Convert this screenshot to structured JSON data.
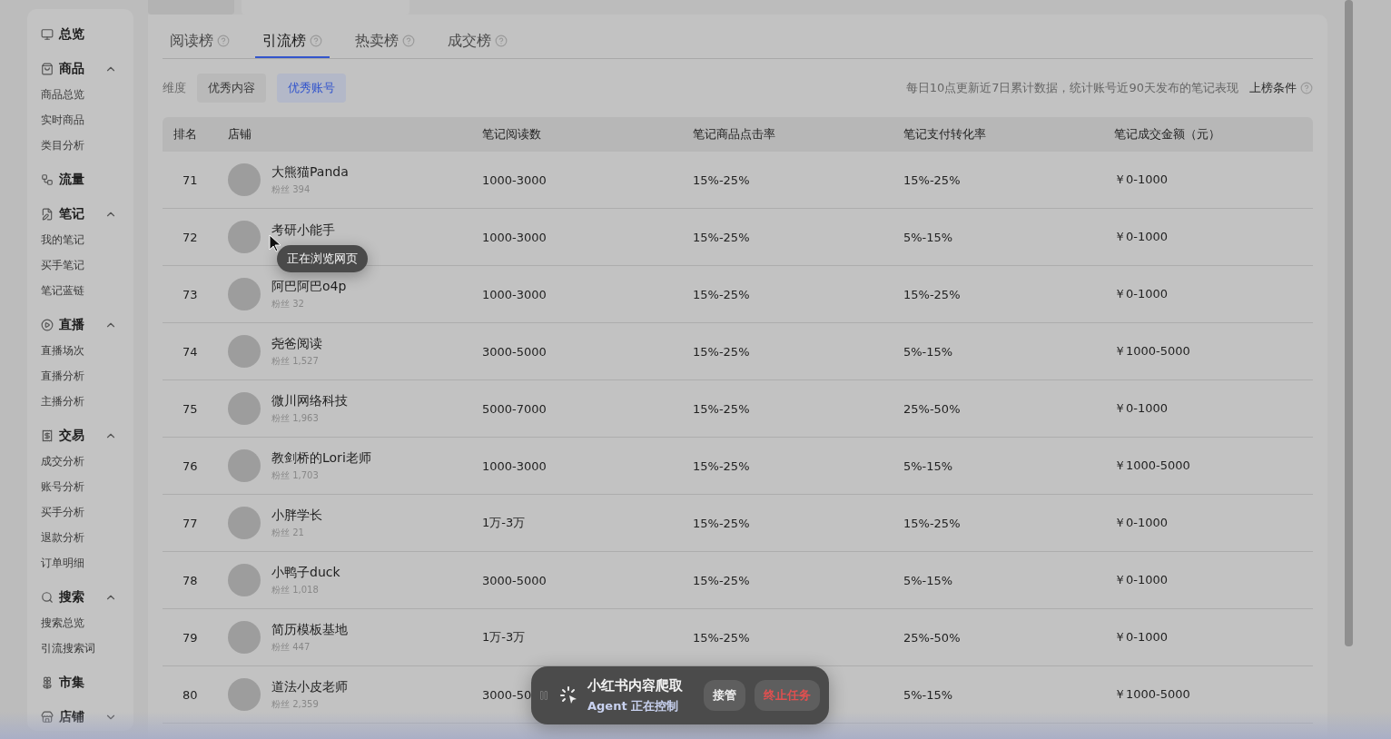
{
  "sidebar": [
    {
      "label": "总览"
    },
    {
      "label": "商品",
      "expanded": true,
      "children": [
        "商品总览",
        "实时商品",
        "类目分析"
      ]
    },
    {
      "label": "流量"
    },
    {
      "label": "笔记",
      "expanded": true,
      "children": [
        "我的笔记",
        "买手笔记",
        "笔记蓝链"
      ]
    },
    {
      "label": "直播",
      "expanded": true,
      "children": [
        "直播场次",
        "直播分析",
        "主播分析"
      ]
    },
    {
      "label": "交易",
      "expanded": true,
      "children": [
        "成交分析",
        "账号分析",
        "买手分析",
        "退款分析",
        "订单明细"
      ]
    },
    {
      "label": "搜索",
      "expanded": true,
      "children": [
        "搜索总览",
        "引流搜索词"
      ]
    },
    {
      "label": "市集"
    },
    {
      "label": "店铺",
      "expanded": false
    }
  ],
  "top_tabs": [
    {
      "selected": false
    },
    {
      "selected": true
    }
  ],
  "tabs": [
    {
      "label": "阅读榜",
      "selected": false
    },
    {
      "label": "引流榜",
      "selected": true
    },
    {
      "label": "热卖榜",
      "selected": false
    },
    {
      "label": "成交榜",
      "selected": false
    }
  ],
  "dimension": {
    "label": "维度",
    "options": [
      {
        "label": "优秀内容",
        "selected": false
      },
      {
        "label": "优秀账号",
        "selected": true
      }
    ]
  },
  "note": "每日10点更新近7日累计数据，统计账号近90天发布的笔记表现",
  "criteria": "上榜条件",
  "table": {
    "columns": [
      "排名",
      "店铺",
      "笔记阅读数",
      "笔记商品点击率",
      "笔记支付转化率",
      "笔记成交金额（元）"
    ],
    "rows": [
      {
        "rank": "71",
        "name": "大熊猫Panda",
        "fans": "粉丝 394",
        "reads": "1000-3000",
        "click": "15%-25%",
        "conversion": "15%-25%",
        "amount": "￥0-1000"
      },
      {
        "rank": "72",
        "name": "考研小能手",
        "reads": "1000-3000",
        "click": "15%-25%",
        "conversion": "5%-15%",
        "amount": "￥0-1000"
      },
      {
        "rank": "73",
        "name": "阿巴阿巴o4p",
        "fans": "粉丝 32",
        "reads": "1000-3000",
        "click": "15%-25%",
        "conversion": "15%-25%",
        "amount": "￥0-1000"
      },
      {
        "rank": "74",
        "name": "尧爸阅读",
        "fans": "粉丝 1,527",
        "reads": "3000-5000",
        "click": "15%-25%",
        "conversion": "5%-15%",
        "amount": "￥1000-5000"
      },
      {
        "rank": "75",
        "name": "微川网络科技",
        "fans": "粉丝 1,963",
        "reads": "5000-7000",
        "click": "15%-25%",
        "conversion": "25%-50%",
        "amount": "￥0-1000"
      },
      {
        "rank": "76",
        "name": "教剑桥的Lori老师",
        "fans": "粉丝 1,703",
        "reads": "1000-3000",
        "click": "15%-25%",
        "conversion": "5%-15%",
        "amount": "￥1000-5000"
      },
      {
        "rank": "77",
        "name": "小胖学长",
        "fans": "粉丝 21",
        "reads": "1万-3万",
        "click": "15%-25%",
        "conversion": "15%-25%",
        "amount": "￥0-1000"
      },
      {
        "rank": "78",
        "name": "小鸭子duck",
        "fans": "粉丝 1,018",
        "reads": "3000-5000",
        "click": "15%-25%",
        "conversion": "5%-15%",
        "amount": "￥0-1000"
      },
      {
        "rank": "79",
        "name": "简历模板基地",
        "fans": "粉丝 447",
        "reads": "1万-3万",
        "click": "15%-25%",
        "conversion": "25%-50%",
        "amount": "￥0-1000"
      },
      {
        "rank": "80",
        "name": "道法小皮老师",
        "fans": "粉丝 2,359",
        "reads": "3000-50",
        "conversion": "5%-15%",
        "amount": "￥1000-5000"
      }
    ]
  },
  "tooltip": "正在浏览网页",
  "agent": {
    "title": "小红书内容爬取",
    "status": "Agent 正在控制",
    "take_over": "接管",
    "stop": "终止任务"
  }
}
